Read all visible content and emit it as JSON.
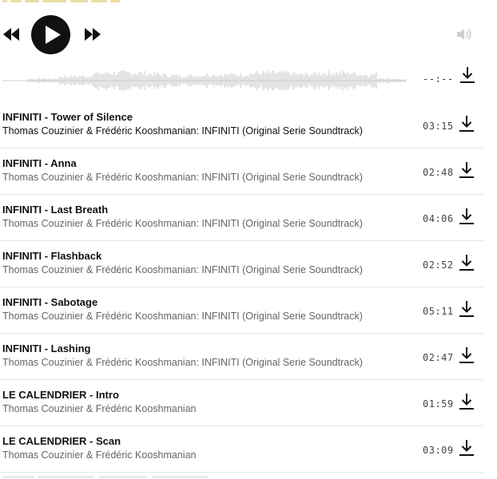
{
  "player": {
    "icons": {
      "prev": "rewind-icon",
      "play": "play-icon",
      "next": "fast-forward-icon",
      "volume": "volume-icon",
      "download": "download-icon"
    },
    "time": "--:--"
  },
  "tracks": [
    {
      "title": "INFINITI - Tower of Silence",
      "artist": "Thomas Couzinier & Frédéric Kooshmanian: INFINITI (Original Serie Soundtrack)",
      "duration": "03:15"
    },
    {
      "title": "INFINITI - Anna",
      "artist": "Thomas Couzinier & Frédéric Kooshmanian: INFINITI (Original Serie Soundtrack)",
      "duration": "02:48"
    },
    {
      "title": "INFINITI - Last Breath",
      "artist": "Thomas Couzinier & Frédéric Kooshmanian: INFINITI (Original Serie Soundtrack)",
      "duration": "04:06"
    },
    {
      "title": "INFINITI - Flashback",
      "artist": "Thomas Couzinier & Frédéric Kooshmanian: INFINITI (Original Serie Soundtrack)",
      "duration": "02:52"
    },
    {
      "title": "INFINITI - Sabotage",
      "artist": "Thomas Couzinier & Frédéric Kooshmanian: INFINITI (Original Serie Soundtrack)",
      "duration": "05:11"
    },
    {
      "title": "INFINITI - Lashing",
      "artist": "Thomas Couzinier & Frédéric Kooshmanian: INFINITI (Original Serie Soundtrack)",
      "duration": "02:47"
    },
    {
      "title": "LE CALENDRIER - Intro",
      "artist": "Thomas Couzinier & Frédéric Kooshmanian",
      "duration": "01:59"
    },
    {
      "title": "LE CALENDRIER - Scan",
      "artist": "Thomas Couzinier & Frédéric Kooshmanian",
      "duration": "03:09"
    }
  ]
}
